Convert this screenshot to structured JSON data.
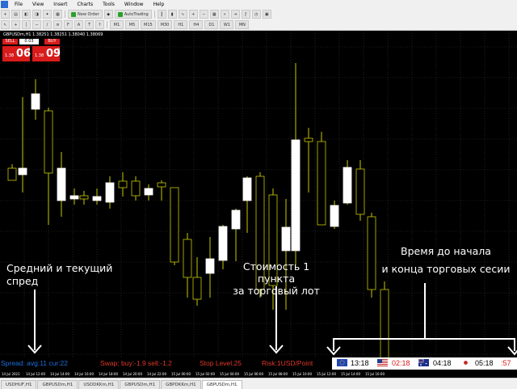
{
  "menu": {
    "items": [
      "File",
      "View",
      "Insert",
      "Charts",
      "Tools",
      "Window",
      "Help"
    ]
  },
  "toolbar": {
    "new_order_label": "New Order",
    "autotrading_label": "AutoTrading",
    "timeframes": [
      "M1",
      "M5",
      "M15",
      "M30",
      "H1",
      "H4",
      "D1",
      "W1",
      "MN"
    ]
  },
  "chart_header": {
    "symbol_line": "GBPUSDm,H1  1.38251 1.38251 1.38040 1.38069"
  },
  "trade_panel": {
    "sell_label": "SELL",
    "buy_label": "BUY",
    "lot": "0.03",
    "sell_price_prefix": "1.38",
    "sell_price_big": "06",
    "sell_price_sup": "9",
    "buy_price_prefix": "1.38",
    "buy_price_big": "09",
    "buy_price_sup": "0"
  },
  "annotations": {
    "spread_note_1": "Средний и текущий",
    "spread_note_2": "спред",
    "point_note_1": "Стоимость 1 пункта",
    "point_note_2": "за торговый лот",
    "session_note_1": "Время до начала",
    "session_note_2": "и конца торговых сесии"
  },
  "info_bar": {
    "spread": "Spread:  avg:11  cur:22",
    "swap": "Swap:  buy:-1.9  sell:-1.2",
    "stop_level": "Stop Level:25",
    "risk": "Risk:1USD/Point"
  },
  "sessions": [
    {
      "flag": "eu-flag",
      "time": "13:18",
      "color": "#000000"
    },
    {
      "flag": "us-flag",
      "time": "02:18",
      "color": "#d81b1b"
    },
    {
      "flag": "au-flag",
      "time": "04:18",
      "color": "#000000"
    },
    {
      "flag": "jp-flag",
      "time": "05:18",
      "color": "#000000"
    }
  ],
  "session_tail": ":57",
  "x_axis": {
    "labels": [
      "14 Jul 2021",
      "14 Jul 12:00",
      "14 Jul 14:00",
      "14 Jul 16:00",
      "14 Jul 18:00",
      "14 Jul 20:00",
      "14 Jul 22:00",
      "15 Jul 00:00",
      "15 Jul 02:00",
      "15 Jul 04:00",
      "15 Jul 06:00",
      "15 Jul 08:00",
      "15 Jul 10:00",
      "15 Jul 12:00",
      "15 Jul 14:00",
      "15 Jul 16:00"
    ]
  },
  "tabs": [
    "USDHUF,H1",
    "GBPUSDm,H1",
    "USDDKKm,H1",
    "GBPUSDm,H1",
    "GBPDKKm,H1",
    "GBPUSDm,H1"
  ],
  "active_tab": 5,
  "colors": {
    "bull_candle": "#ffffff",
    "bear_candle": "#000000",
    "candle_outline": "#c8c800",
    "grid": "#3a3a3a",
    "spread_text": "#1e6fe0",
    "swap_text": "#e0382b",
    "stop_text": "#e0382b",
    "risk_text": "#e0382b"
  }
}
